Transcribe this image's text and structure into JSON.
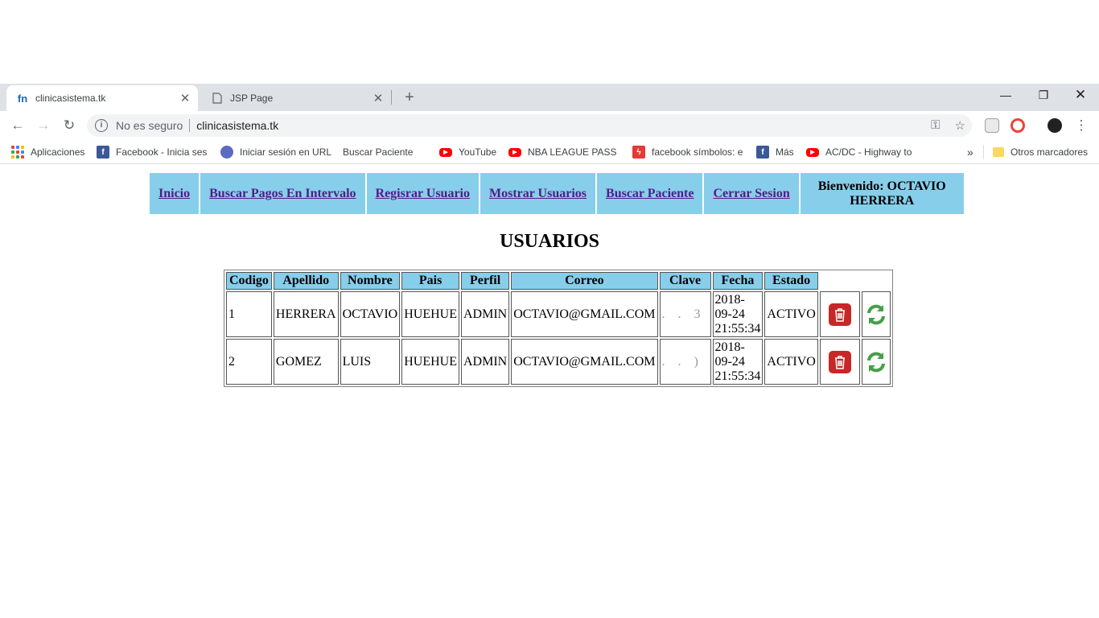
{
  "browser": {
    "tabs": [
      {
        "title": "clinicasistema.tk",
        "active": true
      },
      {
        "title": "JSP Page",
        "active": false
      }
    ],
    "security_label": "No es seguro",
    "url": "clinicasistema.tk",
    "bookmarks": [
      {
        "label": "Aplicaciones",
        "icon": "apps-icon"
      },
      {
        "label": "Facebook - Inicia sesi",
        "icon": "facebook-icon"
      },
      {
        "label": "Iniciar sesión en URL",
        "icon": "globe-icon"
      },
      {
        "label": "Buscar Paciente",
        "icon": "page-icon"
      },
      {
        "label": "YouTube",
        "icon": "youtube-icon"
      },
      {
        "label": "NBA LEAGUE PASS H",
        "icon": "youtube-icon"
      },
      {
        "label": "facebook símbolos: e",
        "icon": "flash-icon"
      },
      {
        "label": "Más",
        "icon": "facebook-icon"
      },
      {
        "label": "AC/DC - Highway to",
        "icon": "youtube-icon"
      }
    ],
    "other_bookmarks": "Otros marcadores"
  },
  "menu": {
    "items": [
      "Inicio",
      "Buscar Pagos En Intervalo",
      "Regisrar Usuario",
      "Mostrar Usuarios",
      "Buscar Paciente",
      "Cerrar Sesion"
    ],
    "welcome": "Bienvenido: OCTAVIO HERRERA"
  },
  "heading": "USUARIOS",
  "table": {
    "columns": [
      "Codigo",
      "Apellido",
      "Nombre",
      "Pais",
      "Perfil",
      "Correo",
      "Clave",
      "Fecha",
      "Estado"
    ],
    "rows": [
      {
        "codigo": "1",
        "apellido": "HERRERA",
        "nombre": "OCTAVIO",
        "pais": "HUEHUE",
        "perfil": "ADMIN",
        "correo": "OCTAVIO@GMAIL.COM",
        "clave": ". . 3",
        "fecha_date": "2018-",
        "fecha_mid": "09-24",
        "fecha_time": "21:55:34",
        "estado": "ACTIVO"
      },
      {
        "codigo": "2",
        "apellido": "GOMEZ",
        "nombre": "LUIS",
        "pais": "HUEHUE",
        "perfil": "ADMIN",
        "correo": "OCTAVIO@GMAIL.COM",
        "clave": ". . )",
        "fecha_date": "2018-",
        "fecha_mid": "09-24",
        "fecha_time": "21:55:34",
        "estado": "ACTIVO"
      }
    ]
  }
}
